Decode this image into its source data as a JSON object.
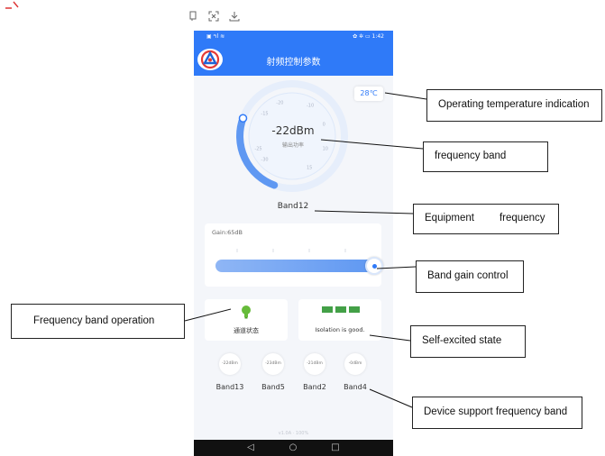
{
  "viewer_toolbar": {
    "icons": [
      "edit-icon",
      "screenshot-icon",
      "download-icon"
    ]
  },
  "phone": {
    "status_left": "▣ ᵃıl ≋",
    "status_right": "✿ ✲ ▭ 1:42",
    "app_title": "射频控制参数",
    "gauge": {
      "value": "-22dBm",
      "sub_label": "输出功率",
      "ticks": [
        "-10",
        "-20",
        "-30",
        "0",
        "10",
        "15",
        "-15",
        "-25"
      ],
      "fill_fraction": 0.22
    },
    "temperature": "28℃",
    "band_name": "Band12",
    "gain_label": "Gain:65dB",
    "gain_fraction": 1.0,
    "channel_state_label": "通道状态",
    "isolation_label": "Isolation is good.",
    "support_bands": [
      {
        "power": "-22dBm",
        "name": "Band13"
      },
      {
        "power": "-23dBm",
        "name": "Band5"
      },
      {
        "power": "-21dBm",
        "name": "Band2"
      },
      {
        "power": "-0dBm",
        "name": "Band4"
      }
    ],
    "version": "v1.0A · 100%",
    "nav": {
      "back": "◁",
      "home": "○",
      "recent": "□"
    }
  },
  "annotations": {
    "temperature": "Operating temperature indication",
    "frequency_band": "frequency band",
    "equipment_frequency_a": "Equipment",
    "equipment_frequency_b": "frequency",
    "band_gain": "Band gain control",
    "frequency_band_operation": "Frequency band operation",
    "self_excited": "Self-excited state",
    "device_support": "Device support frequency band"
  },
  "colors": {
    "header_blue": "#2f7af8",
    "gain_bar": "#6ea0f3",
    "isolation_green": "#43a047",
    "bulb_green": "#66bb3a"
  }
}
